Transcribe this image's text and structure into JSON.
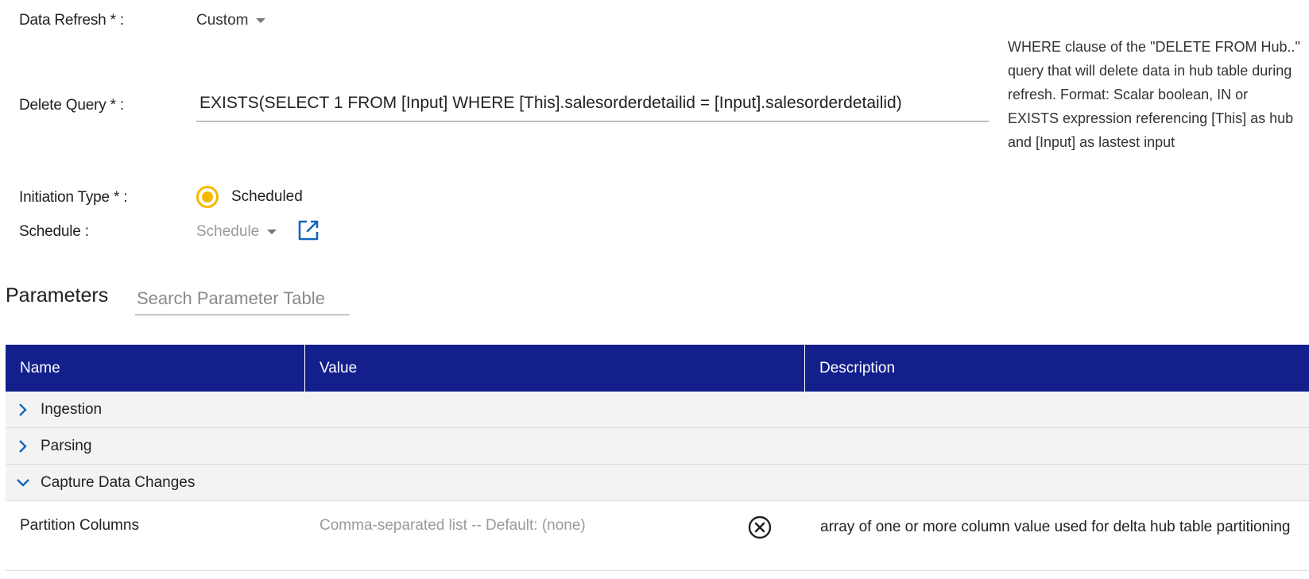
{
  "form": {
    "data_refresh": {
      "label": "Data Refresh * :",
      "value": "Custom"
    },
    "delete_query": {
      "label": "Delete Query * :",
      "value": "EXISTS(SELECT 1 FROM [Input] WHERE [This].salesorderdetailid = [Input].salesorderdetailid)",
      "help": "WHERE clause of the \"DELETE FROM Hub..\" query that will delete data in hub table during refresh. Format: Scalar boolean, IN or EXISTS expression referencing [This] as hub and [Input] as lastest input"
    },
    "initiation_type": {
      "label": "Initiation Type * :",
      "option": "Scheduled"
    },
    "schedule": {
      "label": "Schedule :",
      "placeholder": "Schedule"
    }
  },
  "parameters": {
    "title": "Parameters",
    "search_placeholder": "Search Parameter Table",
    "columns": [
      "Name",
      "Value",
      "Description"
    ],
    "groups": [
      {
        "label": "Ingestion",
        "expanded": false
      },
      {
        "label": "Parsing",
        "expanded": false
      },
      {
        "label": "Capture Data Changes",
        "expanded": true
      }
    ],
    "rows": [
      {
        "name": "Partition Columns",
        "value_placeholder": "Comma-separated list -- Default: (none)",
        "description": "array of one or more column value used for delta hub table partitioning"
      }
    ]
  },
  "icons": {
    "dropdown": "caret-down-icon",
    "external_link": "open-in-new-icon",
    "collapsed": "chevron-right-icon",
    "expanded": "chevron-down-icon",
    "clear": "clear-circle-icon"
  },
  "colors": {
    "header_bg": "#13208c",
    "accent": "#f5b800",
    "link": "#1565c0"
  }
}
